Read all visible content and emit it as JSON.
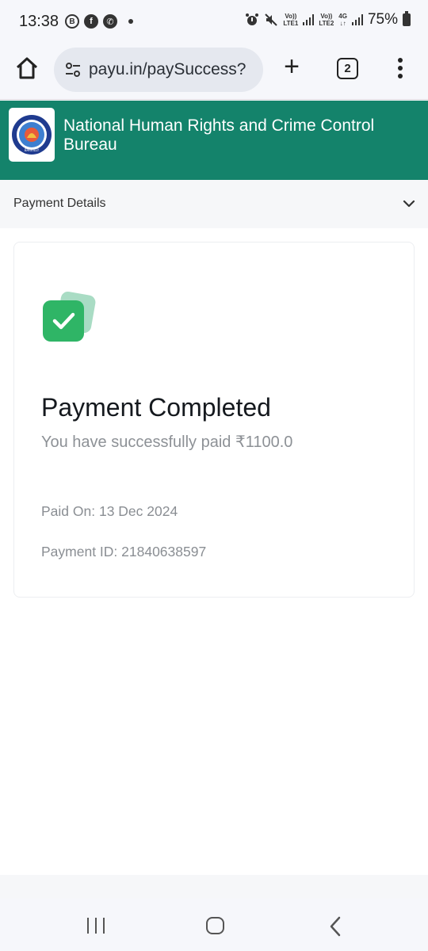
{
  "status_bar": {
    "time": "13:38",
    "icons": [
      "b-circle-icon",
      "facebook-icon",
      "whatsapp-icon",
      "dot-icon"
    ],
    "sim1_label_top": "Vo))",
    "sim1_label_bottom": "LTE1",
    "sim2_label_top": "Vo))",
    "sim2_label_bottom": "LTE2",
    "network_type": "4G",
    "battery_percent": "75%"
  },
  "browser": {
    "url": "payu.in/paySuccess?",
    "tab_count": "2"
  },
  "merchant": {
    "name": "National Human Rights and Crime Control Bureau",
    "logo_text": "BAREILLY",
    "header_color": "#14836b"
  },
  "details_bar": {
    "label": "Payment Details"
  },
  "payment": {
    "title": "Payment Completed",
    "subtitle": "You have successfully paid ₹1100.0",
    "paid_on": "Paid On: 13 Dec 2024",
    "payment_id": "Payment ID: 21840638597",
    "status_color": "#2fb566"
  }
}
